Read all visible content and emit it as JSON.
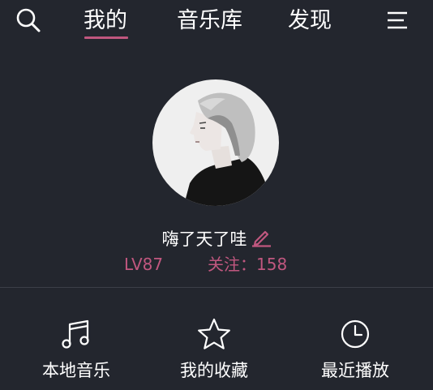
{
  "header": {
    "tabs": [
      {
        "label": "我的",
        "active": true
      },
      {
        "label": "音乐库",
        "active": false
      },
      {
        "label": "发现",
        "active": false
      }
    ],
    "icons": {
      "search": "search-icon",
      "menu": "menu-icon"
    }
  },
  "profile": {
    "username": "嗨了天了哇",
    "level": "LV87",
    "follow_label": "关注",
    "follow_count": "158",
    "follow_text": "关注：158"
  },
  "shortcuts": [
    {
      "label": "本地音乐",
      "icon": "music-note-icon"
    },
    {
      "label": "我的收藏",
      "icon": "star-icon"
    },
    {
      "label": "最近播放",
      "icon": "clock-icon"
    }
  ],
  "colors": {
    "background": "#23262e",
    "accent": "#c0577f",
    "text": "#ffffff",
    "divider": "#3c3f48"
  }
}
